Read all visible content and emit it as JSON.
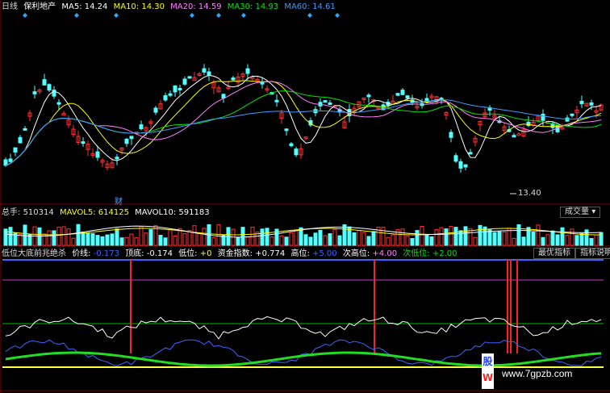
{
  "price_panel": {
    "period": "日线",
    "stock_name": "保利地产",
    "ma5_label": "MA5:",
    "ma5": "14.24",
    "ma10_label": "MA10:",
    "ma10": "14.30",
    "ma20_label": "MA20:",
    "ma20": "14.59",
    "ma30_label": "MA30:",
    "ma30": "14.93",
    "ma60_label": "MA60:",
    "ma60": "14.61",
    "low_marker": "13.40",
    "fin_marker": "财"
  },
  "volume_panel": {
    "vol_label": "总手:",
    "vol": "510314",
    "mavol5_label": "MAVOL5:",
    "mavol5": "614125",
    "mavol10_label": "MAVOL10:",
    "mavol10": "591183",
    "dropdown": "成交量"
  },
  "indicator_panel": {
    "name": "低位大底前兆绝杀",
    "price_line_label": "价线:",
    "price_line": "-0.173",
    "top_label": "顶底:",
    "top": "-0.174",
    "low_label": "低位:",
    "low": "+0",
    "fund_label": "资金指数:",
    "fund": "+0.774",
    "high_label": "高位:",
    "high": "+5.00",
    "sub_high_label": "次高位:",
    "sub_high": "+4.00",
    "sub_low_label": "次低位:",
    "sub_low": "+2.00",
    "btn_best": "最优指标",
    "btn_help": "指标说明"
  },
  "watermark": {
    "site": "www.7gpzb.com",
    "badge_top": "股",
    "badge_bottom": "W"
  },
  "colors": {
    "up": "#ff3232",
    "down": "#54ffff",
    "ma5": "#ffffff",
    "ma10": "#ffff00",
    "ma20": "#ff80ff",
    "ma30": "#00e600",
    "ma60": "#3c9cff",
    "signal": "#ff2020",
    "band_blue": "#3c64ff",
    "band_purple": "#c040c0",
    "band_green": "#00c000",
    "band_yellow": "#ffff40"
  },
  "chart_data": {
    "type": "candlestick",
    "series": [
      {
        "name": "MA5",
        "value": 14.24
      },
      {
        "name": "MA10",
        "value": 14.3
      },
      {
        "name": "MA20",
        "value": 14.59
      },
      {
        "name": "MA30",
        "value": 14.93
      },
      {
        "name": "MA60",
        "value": 14.61
      }
    ],
    "annotations": [
      "13.40",
      "财"
    ],
    "volume": {
      "total": 510314,
      "mavol5": 614125,
      "mavol10": 591183
    },
    "indicator": {
      "price_line": -0.173,
      "top_bottom": -0.174,
      "low": 0,
      "fund_index": 0.774,
      "high": 5.0,
      "sub_high": 4.0,
      "sub_low": 2.0
    }
  }
}
